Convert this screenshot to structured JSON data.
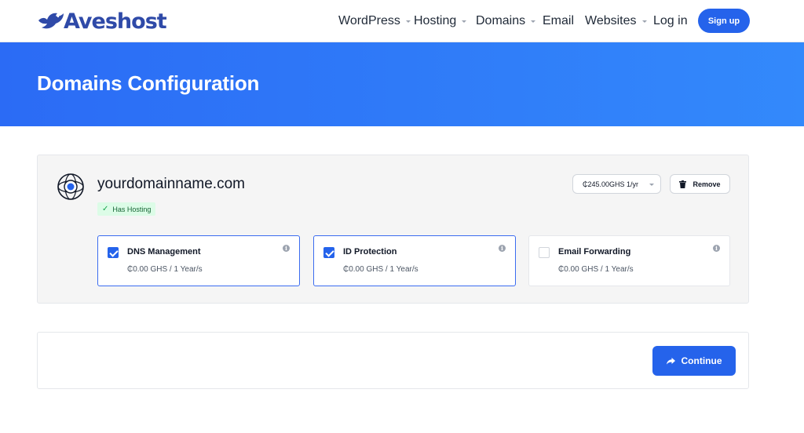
{
  "brand": {
    "name": "Aveshost",
    "logo_icon": "bird-icon",
    "accent": "#2563eb"
  },
  "nav": {
    "items": [
      {
        "label": "WordPress",
        "dropdown": true
      },
      {
        "label": "Hosting",
        "dropdown": true
      },
      {
        "label": "Domains",
        "dropdown": true
      },
      {
        "label": "Email",
        "dropdown": false
      },
      {
        "label": "Websites",
        "dropdown": true
      }
    ],
    "login_label": "Log in",
    "signup_label": "Sign up"
  },
  "hero": {
    "title": "Domains Configuration"
  },
  "domain": {
    "name": "yourdomainname.com",
    "icon": "globe-icon",
    "badge": "Has Hosting",
    "price_option": "₵245.00GHS 1/yr",
    "remove_label": "Remove",
    "addons": [
      {
        "title": "DNS Management",
        "price": "₵0.00 GHS / 1 Year/s",
        "checked": true
      },
      {
        "title": "ID Protection",
        "price": "₵0.00 GHS / 1 Year/s",
        "checked": true
      },
      {
        "title": "Email Forwarding",
        "price": "₵0.00 GHS / 1 Year/s",
        "checked": false
      }
    ]
  },
  "footer": {
    "continue_label": "Continue"
  }
}
